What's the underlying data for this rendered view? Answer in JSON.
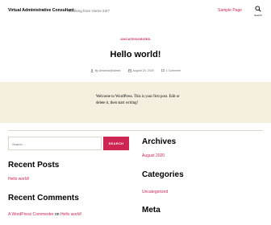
{
  "header": {
    "site_title": "Virtual Administrative Consultant",
    "site_description": "Working from Home 24/7",
    "nav_link": "Sample Page",
    "search_label": "Search"
  },
  "post": {
    "category": "UNCATEGORIZED",
    "title": "Hello world!",
    "author": "By Amanda@admin",
    "date": "August 20, 2020",
    "comments": "1 Comment",
    "content": "Welcome to WordPress. This is your first post. Edit or delete it, then start writing!"
  },
  "search_widget": {
    "placeholder": "Search ...",
    "button": "SEARCH"
  },
  "recent_posts": {
    "heading": "Recent Posts",
    "items": [
      "Hello world!"
    ]
  },
  "recent_comments": {
    "heading": "Recent Comments",
    "author": "A WordPress Commenter",
    "on": "on",
    "post": "Hello world!"
  },
  "archives": {
    "heading": "Archives",
    "items": [
      "August 2020"
    ]
  },
  "categories": {
    "heading": "Categories",
    "items": [
      "Uncategorized"
    ]
  },
  "meta_widget": {
    "heading": "Meta"
  },
  "colors": {
    "accent": "#cd2653",
    "background": "#f5efe0",
    "text": "#000000",
    "secondary": "#6d6d6d"
  }
}
